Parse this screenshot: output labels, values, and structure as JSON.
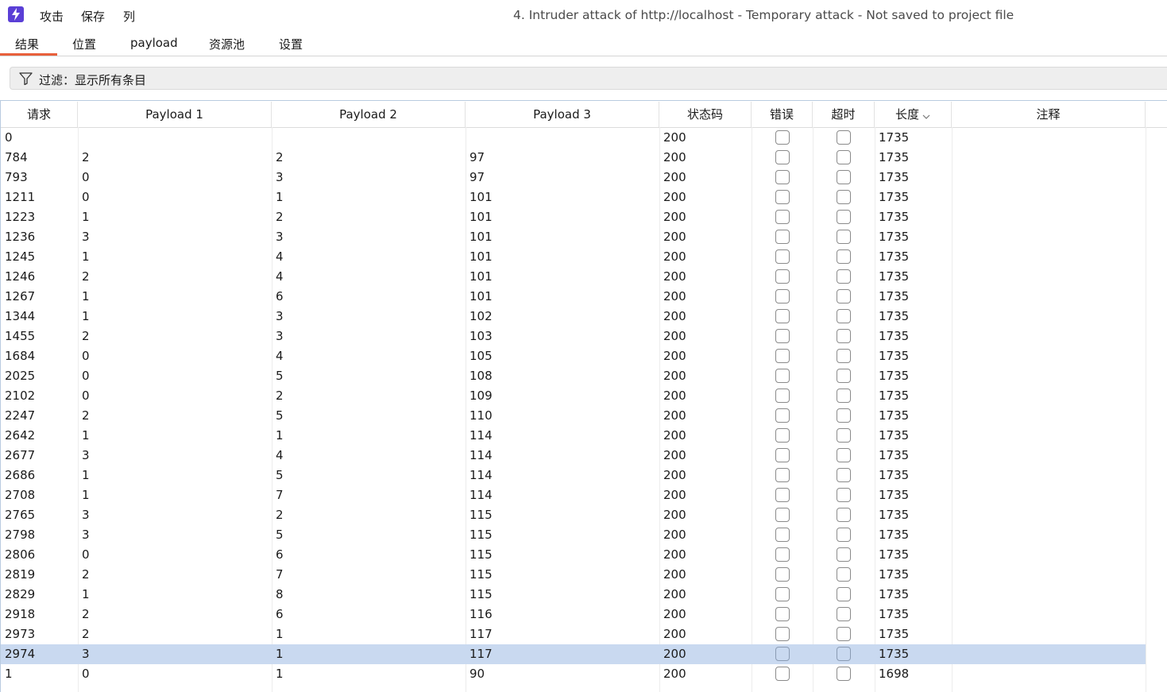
{
  "menu": {
    "attack": "攻击",
    "save": "保存",
    "columns": "列"
  },
  "window_title": "4. Intruder attack of http://localhost - Temporary attack - Not saved to project file",
  "tabs": [
    {
      "label": "结果",
      "active": true
    },
    {
      "label": "位置"
    },
    {
      "label": "payload"
    },
    {
      "label": "资源池"
    },
    {
      "label": "设置"
    }
  ],
  "filter": {
    "label": "过滤：显示所有条目"
  },
  "table": {
    "columns": [
      "请求",
      "Payload 1",
      "Payload 2",
      "Payload 3",
      "状态码",
      "错误",
      "超时",
      "长度",
      "注释"
    ],
    "sorted_column": "长度",
    "selected_request": "2974",
    "rows": [
      {
        "request": "0",
        "p1": "",
        "p2": "",
        "p3": "",
        "status": "200",
        "length": "1735"
      },
      {
        "request": "784",
        "p1": "2",
        "p2": "2",
        "p3": "97",
        "status": "200",
        "length": "1735"
      },
      {
        "request": "793",
        "p1": "0",
        "p2": "3",
        "p3": "97",
        "status": "200",
        "length": "1735"
      },
      {
        "request": "1211",
        "p1": "0",
        "p2": "1",
        "p3": "101",
        "status": "200",
        "length": "1735"
      },
      {
        "request": "1223",
        "p1": "1",
        "p2": "2",
        "p3": "101",
        "status": "200",
        "length": "1735"
      },
      {
        "request": "1236",
        "p1": "3",
        "p2": "3",
        "p3": "101",
        "status": "200",
        "length": "1735"
      },
      {
        "request": "1245",
        "p1": "1",
        "p2": "4",
        "p3": "101",
        "status": "200",
        "length": "1735"
      },
      {
        "request": "1246",
        "p1": "2",
        "p2": "4",
        "p3": "101",
        "status": "200",
        "length": "1735"
      },
      {
        "request": "1267",
        "p1": "1",
        "p2": "6",
        "p3": "101",
        "status": "200",
        "length": "1735"
      },
      {
        "request": "1344",
        "p1": "1",
        "p2": "3",
        "p3": "102",
        "status": "200",
        "length": "1735"
      },
      {
        "request": "1455",
        "p1": "2",
        "p2": "3",
        "p3": "103",
        "status": "200",
        "length": "1735"
      },
      {
        "request": "1684",
        "p1": "0",
        "p2": "4",
        "p3": "105",
        "status": "200",
        "length": "1735"
      },
      {
        "request": "2025",
        "p1": "0",
        "p2": "5",
        "p3": "108",
        "status": "200",
        "length": "1735"
      },
      {
        "request": "2102",
        "p1": "0",
        "p2": "2",
        "p3": "109",
        "status": "200",
        "length": "1735"
      },
      {
        "request": "2247",
        "p1": "2",
        "p2": "5",
        "p3": "110",
        "status": "200",
        "length": "1735"
      },
      {
        "request": "2642",
        "p1": "1",
        "p2": "1",
        "p3": "114",
        "status": "200",
        "length": "1735"
      },
      {
        "request": "2677",
        "p1": "3",
        "p2": "4",
        "p3": "114",
        "status": "200",
        "length": "1735"
      },
      {
        "request": "2686",
        "p1": "1",
        "p2": "5",
        "p3": "114",
        "status": "200",
        "length": "1735"
      },
      {
        "request": "2708",
        "p1": "1",
        "p2": "7",
        "p3": "114",
        "status": "200",
        "length": "1735"
      },
      {
        "request": "2765",
        "p1": "3",
        "p2": "2",
        "p3": "115",
        "status": "200",
        "length": "1735"
      },
      {
        "request": "2798",
        "p1": "3",
        "p2": "5",
        "p3": "115",
        "status": "200",
        "length": "1735"
      },
      {
        "request": "2806",
        "p1": "0",
        "p2": "6",
        "p3": "115",
        "status": "200",
        "length": "1735"
      },
      {
        "request": "2819",
        "p1": "2",
        "p2": "7",
        "p3": "115",
        "status": "200",
        "length": "1735"
      },
      {
        "request": "2829",
        "p1": "1",
        "p2": "8",
        "p3": "115",
        "status": "200",
        "length": "1735"
      },
      {
        "request": "2918",
        "p1": "2",
        "p2": "6",
        "p3": "116",
        "status": "200",
        "length": "1735"
      },
      {
        "request": "2973",
        "p1": "2",
        "p2": "1",
        "p3": "117",
        "status": "200",
        "length": "1735"
      },
      {
        "request": "2974",
        "p1": "3",
        "p2": "1",
        "p3": "117",
        "status": "200",
        "length": "1735"
      },
      {
        "request": "1",
        "p1": "0",
        "p2": "1",
        "p3": "90",
        "status": "200",
        "length": "1698"
      }
    ]
  },
  "colors": {
    "accent_tab": "#e8603c",
    "selection": "#c9d9f0",
    "app_icon": "#5a3fd6"
  }
}
